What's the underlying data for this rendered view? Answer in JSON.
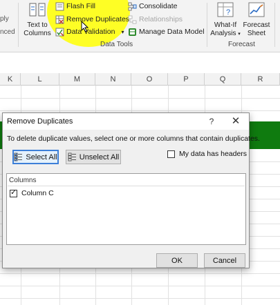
{
  "ribbon": {
    "partial_left_top": "ply",
    "partial_left_bottom": "nced",
    "text_to_columns": {
      "line1": "Text to",
      "line2": "Columns"
    },
    "flash_fill": "Flash Fill",
    "remove_duplicates": "Remove Duplicates",
    "data_validation": "Data Validation",
    "data_validation_arrow": "▾",
    "consolidate": "Consolidate",
    "relationships": "Relationships",
    "manage_data_model": "Manage Data Model",
    "group_data_tools": "Data Tools",
    "what_if": {
      "line1": "What-If",
      "line2": "Analysis",
      "arrow": "▾"
    },
    "forecast_sheet": {
      "line1": "Forecast",
      "line2": "Sheet"
    },
    "group_forecast": "Forecast",
    "colors": {
      "highlight": "#ffff00",
      "accent_green": "#217346"
    }
  },
  "sheet": {
    "columns": [
      "K",
      "L",
      "M",
      "N",
      "O",
      "P",
      "Q",
      "R"
    ],
    "band_color": "#0f7b0f"
  },
  "dialog": {
    "title": "Remove Duplicates",
    "help": "?",
    "close": "✕",
    "instruction": "To delete duplicate values, select one or more columns that contain duplicates.",
    "select_all": "Select All",
    "unselect_all": "Unselect All",
    "my_data_has_headers": "My data has headers",
    "headers_checked": false,
    "columns_header": "Columns",
    "column_items": [
      {
        "label": "Column C",
        "checked": true
      }
    ],
    "ok": "OK",
    "cancel": "Cancel",
    "focus_color": "#3c7fd8"
  }
}
